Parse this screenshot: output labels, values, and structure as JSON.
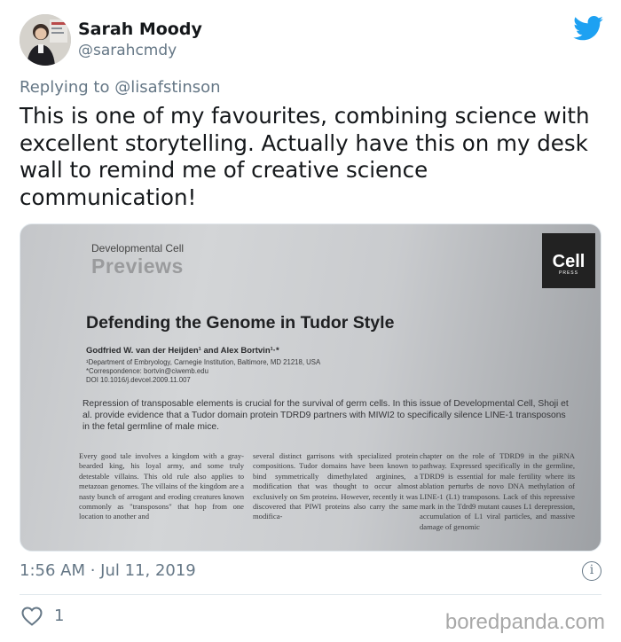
{
  "user": {
    "name": "Sarah Moody",
    "handle": "@sarahcmdy",
    "avatar": "avatar-photo"
  },
  "brand_icon": "twitter-bird-icon",
  "brand_color": "#1da1f2",
  "reply": {
    "text": "Replying to @lisafstinson"
  },
  "tweet": {
    "text": "This is one of my favourites, combining science with excellent storytelling. Actually have this on my desk wall to remind me of creative science communication!"
  },
  "photo": {
    "journal": "Developmental Cell",
    "section": "Previews",
    "logo_word": "Cell",
    "logo_sub": "PRESS",
    "title": "Defending the Genome in Tudor Style",
    "authors": "Godfried W. van der Heijden¹ and Alex Bortvin¹·*",
    "affiliation": "¹Department of Embryology, Carnegie Institution, Baltimore, MD 21218, USA\n*Correspondence: bortvin@ciwemb.edu\nDOI 10.1016/j.devcel.2009.11.007",
    "abstract": "Repression of transposable elements is crucial for the survival of germ cells. In this issue of Developmental Cell, Shoji et al. provide evidence that a Tudor domain protein TDRD9 partners with MIWI2 to specifically silence LINE-1 transposons in the fetal germline of male mice.",
    "col1": "Every good tale involves a kingdom with a gray-bearded king, his loyal army, and some truly detestable villains. This old rule also applies to metazoan genomes. The villains of the kingdom are a nasty bunch of arrogant and eroding creatures known commonly as \"transposons\" that hop from one location to another and",
    "col2": "several distinct garrisons with specialized protein compositions. Tudor domains have been known to bind symmetrically dimethylated arginines, a modification that was thought to occur almost exclusively on Sm proteins. However, recently it was discovered that PIWI proteins also carry the same modifica-",
    "col3": "chapter on the role of TDRD9 in the piRNA pathway. Expressed specifically in the germline, TDRD9 is essential for male fertility where its ablation perturbs de novo DNA methylation of LINE-1 (L1) transposons. Lack of this repressive mark in the Tdrd9 mutant causes L1 derepression, accumulation of L1 viral particles, and massive damage of genomic"
  },
  "meta": {
    "timestamp": "1:56 AM · Jul 11, 2019",
    "info_glyph": "i",
    "likes": "1",
    "watermark": "boredpanda.com"
  }
}
